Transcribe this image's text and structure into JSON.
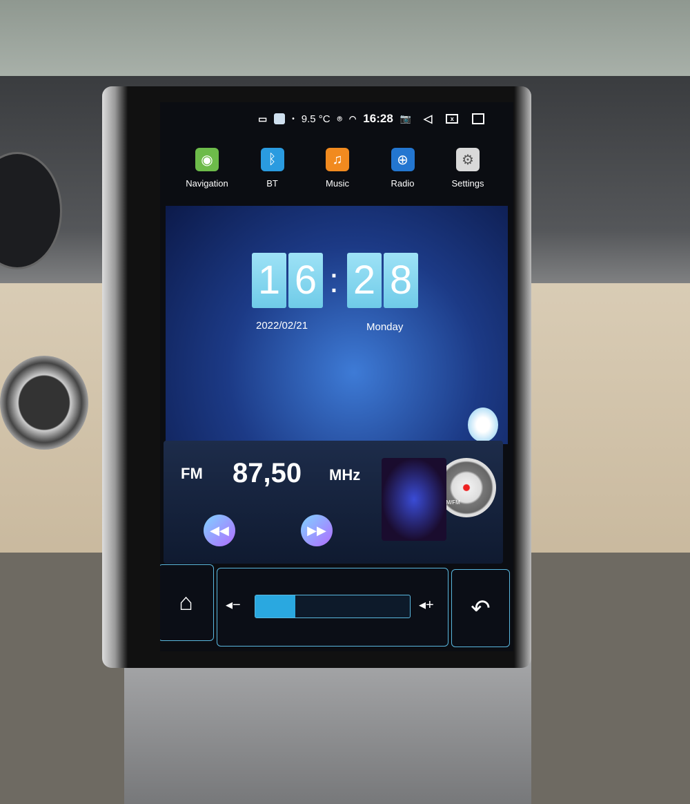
{
  "status_bar": {
    "temperature": "9.5 °C",
    "time": "16:28"
  },
  "apps": [
    {
      "label": "Navigation",
      "icon": "map-pin-icon",
      "color": "#6dbb4a"
    },
    {
      "label": "BT",
      "icon": "bluetooth-icon",
      "color": "#2a9be0"
    },
    {
      "label": "Music",
      "icon": "music-note-icon",
      "color": "#f18a1f"
    },
    {
      "label": "Radio",
      "icon": "radio-globe-icon",
      "color": "#2376d0"
    },
    {
      "label": "Settings",
      "icon": "gear-icon",
      "color": "#d9d9d9"
    }
  ],
  "clock": {
    "h1": "1",
    "h2": "6",
    "sep": ":",
    "m1": "2",
    "m2": "8",
    "date": "2022/02/21",
    "weekday": "Monday"
  },
  "radio": {
    "band": "FM",
    "frequency": "87,50",
    "unit": "MHz",
    "dial_label": "AM/FM"
  },
  "volume": {
    "level_percent": 26
  },
  "colors": {
    "accent": "#5ab8e0",
    "volume_fill": "#2aa8e0"
  }
}
